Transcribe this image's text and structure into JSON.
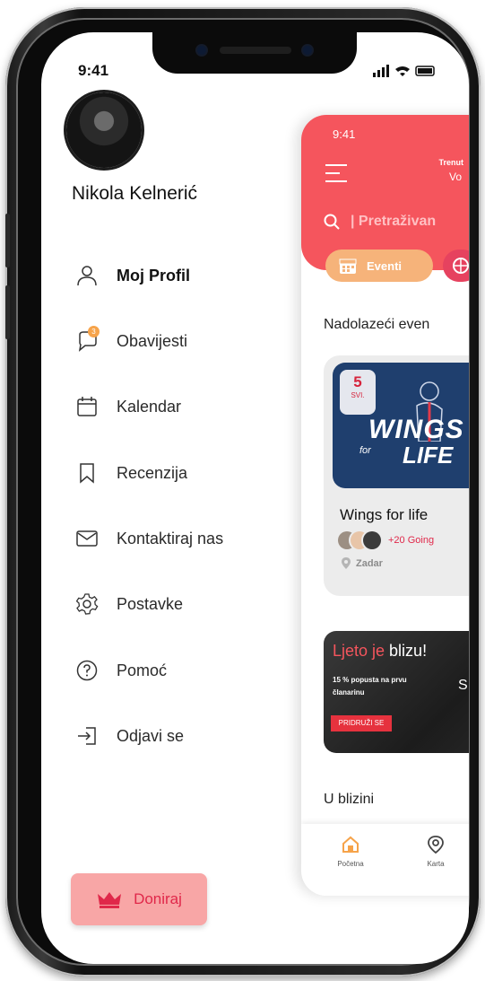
{
  "status_bar": {
    "time": "9:41"
  },
  "drawer": {
    "user_name": "Nikola Kelnerić",
    "menu": [
      {
        "label": "Moj Profil",
        "icon": "user-icon",
        "active": true
      },
      {
        "label": "Obavijesti",
        "icon": "chat-bubble-icon",
        "badge": "3"
      },
      {
        "label": "Kalendar",
        "icon": "calendar-icon"
      },
      {
        "label": "Recenzija",
        "icon": "bookmark-icon"
      },
      {
        "label": "Kontaktiraj nas",
        "icon": "mail-icon"
      },
      {
        "label": "Postavke",
        "icon": "gear-icon"
      },
      {
        "label": "Pomoć",
        "icon": "help-icon"
      },
      {
        "label": "Odjavi se",
        "icon": "logout-icon"
      }
    ],
    "donate_label": "Doniraj"
  },
  "app": {
    "time": "9:41",
    "trending_line1": "Trenut",
    "trending_line2": "Vo",
    "search_placeholder": "Pretraživan",
    "eventi_label": "Eventi",
    "section_title": "Nadolazeći even",
    "event": {
      "day": "5",
      "month": "SVI.",
      "image_text_1": "WINGS",
      "image_text_2": "LIFE",
      "image_text_small": "for",
      "title": "Wings for life",
      "going": "+20 Going",
      "location": "Zadar"
    },
    "promo": {
      "title_hl": "Ljeto je",
      "title_rest": " blizu!",
      "subtitle": "15 % popusta na prvu članarinu",
      "button": "PRIDRUŽI SE",
      "side_letter": "S"
    },
    "nearby_title": "U blizini",
    "nav": [
      {
        "label": "Početna",
        "icon": "home-icon"
      },
      {
        "label": "Karta",
        "icon": "map-pin-icon"
      }
    ]
  },
  "colors": {
    "accent": "#f5555d",
    "orange": "#f6b37a",
    "badge": "#f6a34a",
    "donate_bg": "#f8a6a6",
    "donate_text": "#e0284a"
  }
}
